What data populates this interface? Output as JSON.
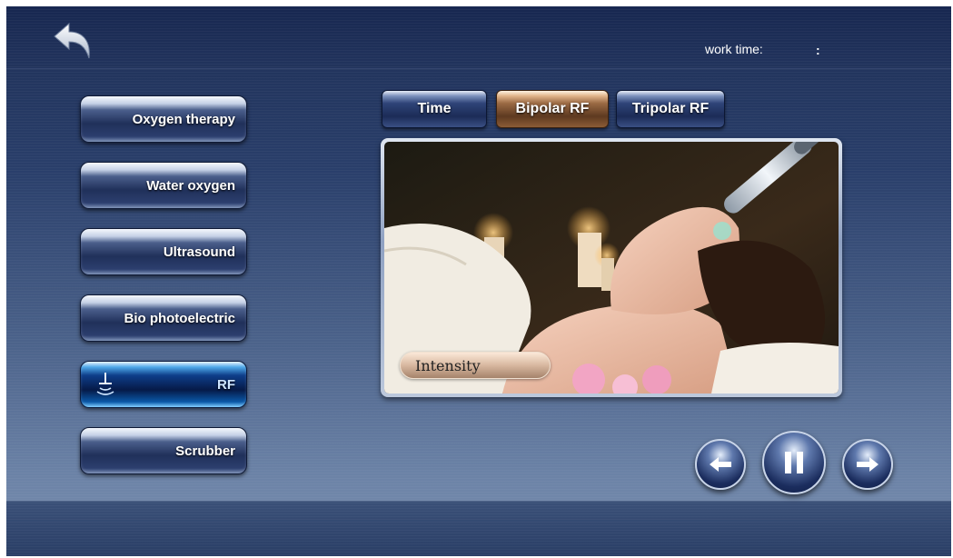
{
  "header": {
    "work_time_label": "work time:",
    "work_time_value": ":"
  },
  "sidebar": {
    "items": [
      {
        "label": "Oxygen therapy",
        "active": false
      },
      {
        "label": "Water oxygen",
        "active": false
      },
      {
        "label": "Ultrasound",
        "active": false
      },
      {
        "label": "Bio photoelectric",
        "active": false
      },
      {
        "label": "RF",
        "active": true,
        "icon": "rf-probe-icon"
      },
      {
        "label": "Scrubber",
        "active": false
      }
    ]
  },
  "tabs": [
    {
      "label": "Time",
      "active": false
    },
    {
      "label": "Bipolar RF",
      "active": true
    },
    {
      "label": "Tripolar RF",
      "active": false
    }
  ],
  "preview": {
    "overlay_label": "Intensity"
  },
  "controls": {
    "icons": [
      "arrow-left-icon",
      "pause-icon",
      "arrow-right-icon"
    ]
  },
  "colors": {
    "active_tab": "#8b5c36",
    "active_sidebar": "#0a57a6",
    "panel_dark": "#1d2e55"
  }
}
